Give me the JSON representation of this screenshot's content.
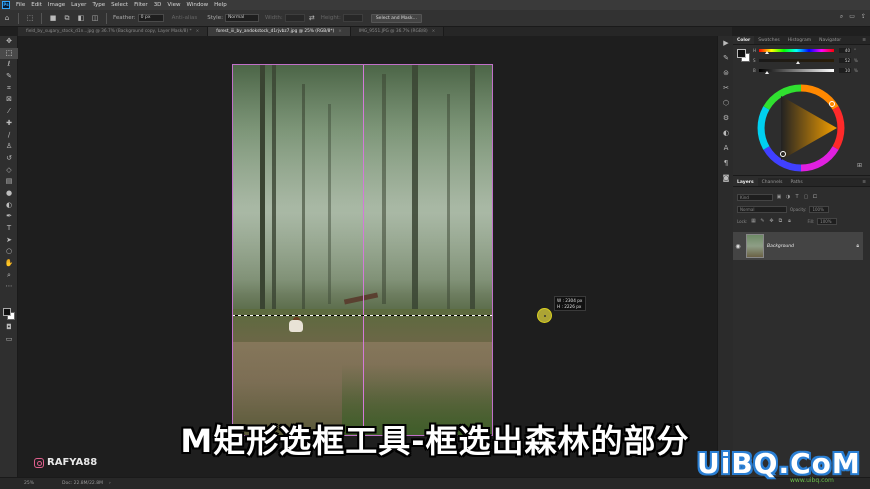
{
  "menu": [
    "File",
    "Edit",
    "Image",
    "Layer",
    "Type",
    "Select",
    "Filter",
    "3D",
    "View",
    "Window",
    "Help"
  ],
  "options": {
    "feather_label": "Feather:",
    "feather_value": "0 px",
    "antialias_label": "Anti-alias",
    "style_label": "Style:",
    "style_value": "Normal",
    "width_label": "Width:",
    "height_label": "Height:",
    "select_mask_label": "Select and Mask..."
  },
  "tabs": [
    {
      "label": "field_by_sugary_stock_d1n...jpg @ 36.7% (Background copy, Layer Mask/8) *"
    },
    {
      "label": "forest_iii_by_andokstock_d1rjvbz7.jpg @ 25% (RGB/8*)"
    },
    {
      "label": "IMG_9551.JPG @ 36.7% (RGB/8)"
    }
  ],
  "size_tooltip": {
    "w": "W :  2304 px",
    "h": "H :  2226 px"
  },
  "color_panel": {
    "tabs": [
      "Color",
      "Swatches",
      "Histogram",
      "Navigator"
    ],
    "sliders": [
      {
        "label": "H",
        "value": "40",
        "unit": "°",
        "fraction": 0.11
      },
      {
        "label": "S",
        "value": "52",
        "unit": "%",
        "fraction": 0.52
      },
      {
        "label": "B",
        "value": "10",
        "unit": "%",
        "fraction": 0.1
      }
    ]
  },
  "layers_panel": {
    "tabs": [
      "Layers",
      "Channels",
      "Paths"
    ],
    "kind_placeholder": "Kind",
    "blend_mode": "Normal",
    "opacity_label": "Opacity:",
    "opacity_value": "100%",
    "lock_label": "Lock:",
    "fill_label": "Fill:",
    "fill_value": "100%",
    "layer_name": "Background"
  },
  "status": {
    "zoom": "25%",
    "doc": "Doc: 22.8M/22.8M"
  },
  "subtitle": "M矩形选框工具-框选出森林的部分",
  "instagram_handle": "RAFYA88",
  "watermark": "UiBQ.CoM",
  "watermark_sub": "www.uibq.com"
}
